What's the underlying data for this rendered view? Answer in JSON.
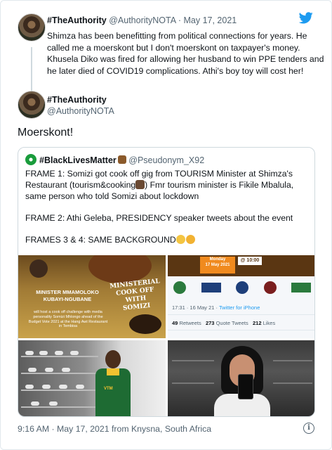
{
  "parent_tweet": {
    "display_name": "#TheAuthority",
    "handle": "@AuthorityNOTA",
    "separator": "·",
    "date": "May 17, 2021",
    "text": "Shimza has been benefitting from political connections for years. He called me a moerskont but I don't moerskont on taxpayer's money. Khusela Diko was fired for allowing her husband to win PPE tenders and he later died of COVID19 complications. Athi's boy toy will cost her!"
  },
  "main_tweet": {
    "display_name": "#TheAuthority",
    "handle": "@AuthorityNOTA",
    "text": "Moerskont!",
    "timestamp": "9:16 AM · May 17, 2021 from Knysna, South Africa"
  },
  "quoted_tweet": {
    "display_name": "#BlackLivesMatter",
    "handle": "@Pseudonym_X92",
    "frame1_a": "FRAME 1: Somizi got cook off gig from TOURISM Minister at Shimza's Restaurant (tourism&cooking",
    "frame1_b": ") Fmr tourism minister is Fikile Mbalula, same person who told Somizi about lockdown",
    "frame2": "FRAME 2: Athi Geleba, PRESIDENCY speaker tweets about the event",
    "frame3": "FRAMES 3 & 4: SAME BACKGROUND"
  },
  "media": {
    "poster_title": "MINISTERIAL COOK OFF WITH SOMIZI",
    "poster_minister": "MINISTER MMAMOLOKO KUBAYI-NGUBANE",
    "poster_desc": "will host a cook off challenge with media personality Somizi Mhlongo ahead of the Budget Vote 2021 at the Hang Awt Restaurant in Tembisa",
    "embed_day": "Monday",
    "embed_date": "17 May 2021",
    "embed_time": "@ 10:00",
    "embed_stamp_time": "17:31 · 16 May 21 ·",
    "embed_stamp_client": "Twitter for iPhone",
    "retweets_count": "49",
    "retweets_label": "Retweets",
    "quotes_count": "273",
    "quotes_label": "Quote Tweets",
    "likes_count": "212",
    "likes_label": "Likes",
    "shirt_badge": "VTM"
  },
  "colors": {
    "twitter_blue": "#1d9bf0",
    "muted_text": "#536471",
    "border": "#cfd9de"
  },
  "icons": {
    "brand": "twitter-bird-icon",
    "info": "info-icon"
  }
}
